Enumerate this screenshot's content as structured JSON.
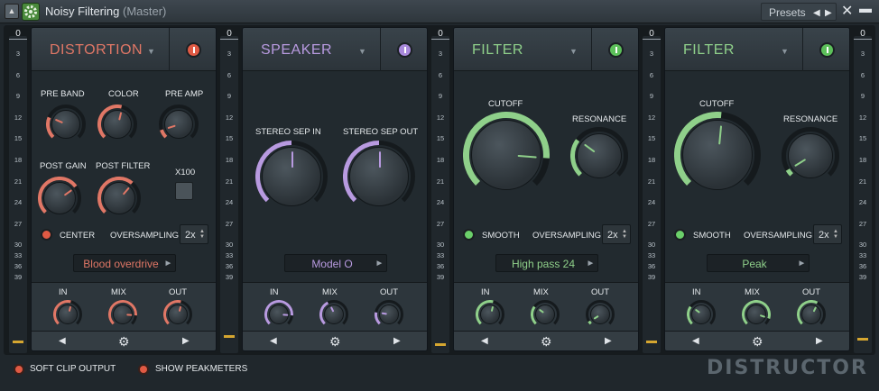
{
  "titlebar": {
    "collapse_icon": "up-triangle",
    "gear_icon": "gear",
    "title": "Noisy Filtering",
    "subtitle": "(Master)",
    "presets_label": "Presets",
    "prev_icon": "left-triangle",
    "next_icon": "right-triangle",
    "close_icon": "x-close",
    "minimize_icon": "minimize"
  },
  "meter_ticks": [
    "0",
    "3",
    "6",
    "9",
    "12",
    "15",
    "18",
    "21",
    "24",
    "27",
    "30",
    "33",
    "36",
    "39"
  ],
  "meter_levels": [
    0.02,
    0.04,
    0.01,
    0.02,
    0.03
  ],
  "modules": [
    {
      "name": "DISTORTION",
      "color": "#e07766",
      "power_color": "#e05a44",
      "knobs": [
        {
          "label": "PRE BAND",
          "value": 0.25
        },
        {
          "label": "COLOR",
          "value": 0.55
        },
        {
          "label": "PRE AMP",
          "value": 0.1
        },
        {
          "label": "POST GAIN",
          "value": 0.7
        },
        {
          "label": "POST FILTER",
          "value": 0.65
        }
      ],
      "x100_label": "X100",
      "led_label": "CENTER",
      "oversampling_label": "OVERSAMPLING",
      "oversampling_value": "2x",
      "mode": "Blood overdrive",
      "mix": [
        {
          "label": "IN",
          "value": 0.55
        },
        {
          "label": "MIX",
          "value": 0.85
        },
        {
          "label": "OUT",
          "value": 0.55
        }
      ]
    },
    {
      "name": "SPEAKER",
      "color": "#b89ae0",
      "power_color": "#a889db",
      "knobs": [
        {
          "label": "STEREO SEP IN",
          "value": 0.5
        },
        {
          "label": "STEREO SEP OUT",
          "value": 0.5
        }
      ],
      "mode": "Model O",
      "mix": [
        {
          "label": "IN",
          "value": 0.85
        },
        {
          "label": "MIX",
          "value": 0.4
        },
        {
          "label": "OUT",
          "value": 0.2
        }
      ]
    },
    {
      "name": "FILTER",
      "color": "#8fd08a",
      "power_color": "#5cc05a",
      "knobs": [
        {
          "label": "CUTOFF",
          "value": 0.85
        },
        {
          "label": "RESONANCE",
          "value": 0.3
        }
      ],
      "led_label": "SMOOTH",
      "oversampling_label": "OVERSAMPLING",
      "oversampling_value": "2x",
      "mode": "High pass 24",
      "mix": [
        {
          "label": "IN",
          "value": 0.55
        },
        {
          "label": "MIX",
          "value": 0.3
        },
        {
          "label": "OUT",
          "value": 0.05
        }
      ]
    },
    {
      "name": "FILTER",
      "color": "#8fd08a",
      "power_color": "#5cc05a",
      "knobs": [
        {
          "label": "CUTOFF",
          "value": 0.52
        },
        {
          "label": "RESONANCE",
          "value": 0.05
        }
      ],
      "led_label": "SMOOTH",
      "oversampling_label": "OVERSAMPLING",
      "oversampling_value": "2x",
      "mode": "Peak",
      "mix": [
        {
          "label": "IN",
          "value": 0.3
        },
        {
          "label": "MIX",
          "value": 0.9
        },
        {
          "label": "OUT",
          "value": 0.6
        }
      ]
    }
  ],
  "nav": {
    "prev_icon": "left-triangle",
    "settings_icon": "gear",
    "next_icon": "right-triangle"
  },
  "footer": {
    "soft_clip_label": "SOFT CLIP OUTPUT",
    "show_peak_label": "SHOW PEAKMETERS",
    "logo": "DISTRUCTOR"
  }
}
